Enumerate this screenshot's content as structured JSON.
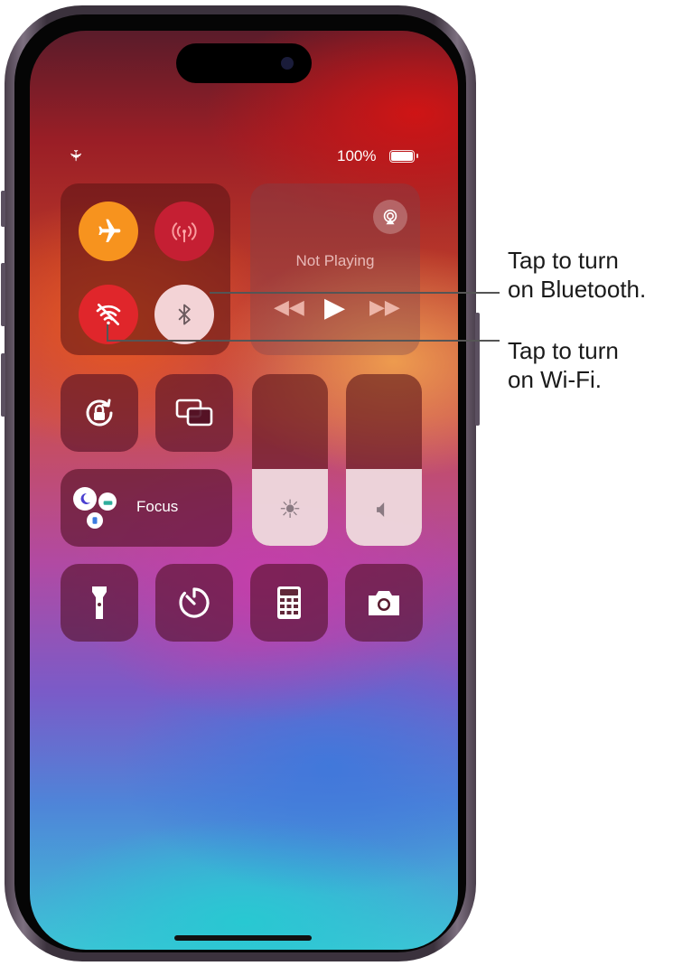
{
  "status_bar": {
    "battery_percent": "100%",
    "airplane_icon": "airplane-icon"
  },
  "connectivity": {
    "airplane_mode": {
      "icon": "airplane-icon",
      "state": "on",
      "color": "#F7931E"
    },
    "cellular_data": {
      "icon": "antenna-icon",
      "state": "on",
      "color": "#D8203A"
    },
    "wifi": {
      "icon": "wifi-off-icon",
      "state": "off-red",
      "color": "#E0262B"
    },
    "bluetooth": {
      "icon": "bluetooth-icon",
      "state": "off",
      "color": "#F3D3D6"
    }
  },
  "media": {
    "status": "Not Playing",
    "airplay_icon": "airplay-icon"
  },
  "controls": {
    "orientation_lock_icon": "rotation-lock-icon",
    "screen_mirroring_icon": "screen-mirroring-icon",
    "focus_label": "Focus",
    "brightness_level": 0.45,
    "volume_level": 0.45,
    "flashlight_icon": "flashlight-icon",
    "timer_icon": "timer-icon",
    "calculator_icon": "calculator-icon",
    "camera_icon": "camera-icon"
  },
  "callouts": {
    "bluetooth_line1": "Tap to turn",
    "bluetooth_line2": "on Bluetooth.",
    "wifi_line1": "Tap to turn",
    "wifi_line2": "on Wi-Fi."
  }
}
